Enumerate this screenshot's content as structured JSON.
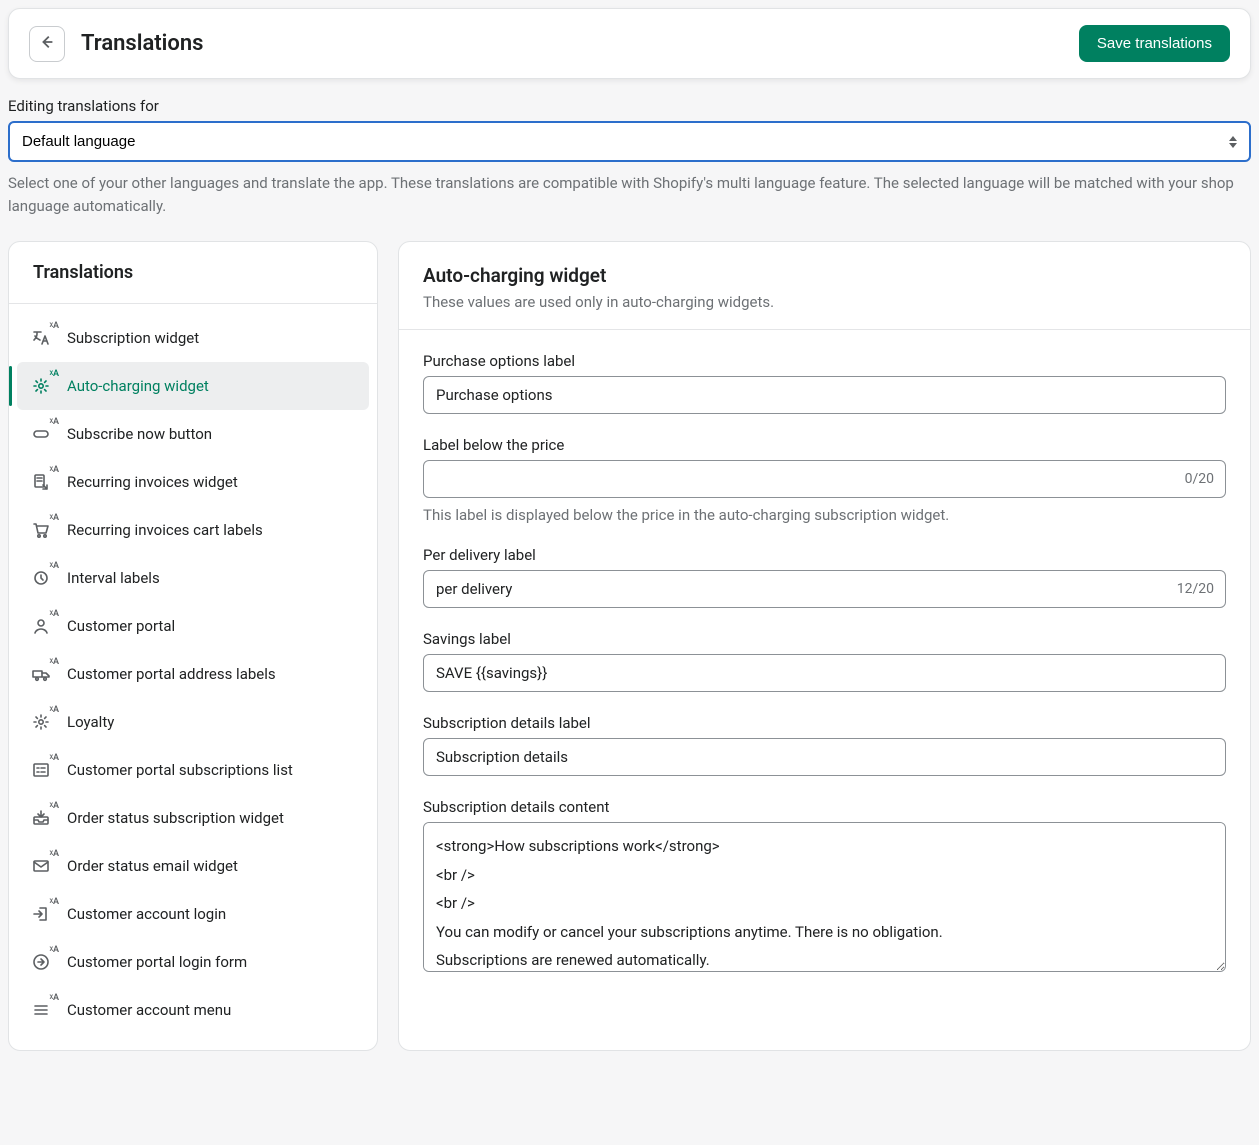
{
  "header": {
    "title": "Translations",
    "save_label": "Save translations"
  },
  "language": {
    "label": "Editing translations for",
    "selected": "Default language",
    "help": "Select one of your other languages and translate the app. These translations are compatible with Shopify's multi language feature. The selected language will be matched with your shop language automatically."
  },
  "sidebar": {
    "title": "Translations",
    "badge": "ᵡA",
    "items": [
      {
        "label": "Subscription widget",
        "icon": "translate"
      },
      {
        "label": "Auto-charging widget",
        "icon": "gear",
        "active": true
      },
      {
        "label": "Subscribe now button",
        "icon": "button"
      },
      {
        "label": "Recurring invoices widget",
        "icon": "invoice-out"
      },
      {
        "label": "Recurring invoices cart labels",
        "icon": "cart"
      },
      {
        "label": "Interval labels",
        "icon": "clock"
      },
      {
        "label": "Customer portal",
        "icon": "person"
      },
      {
        "label": "Customer portal address labels",
        "icon": "truck"
      },
      {
        "label": "Loyalty",
        "icon": "gear"
      },
      {
        "label": "Customer portal subscriptions list",
        "icon": "list-box"
      },
      {
        "label": "Order status subscription widget",
        "icon": "inbox"
      },
      {
        "label": "Order status email widget",
        "icon": "mail"
      },
      {
        "label": "Customer account login",
        "icon": "login"
      },
      {
        "label": "Customer portal login form",
        "icon": "login-circle"
      },
      {
        "label": "Customer account menu",
        "icon": "menu"
      }
    ]
  },
  "section": {
    "title": "Auto-charging widget",
    "subtitle": "These values are used only in auto-charging widgets."
  },
  "fields": {
    "purchase_options": {
      "label": "Purchase options label",
      "value": "Purchase options"
    },
    "label_below_price": {
      "label": "Label below the price",
      "value": "",
      "count": "0/20",
      "help": "This label is displayed below the price in the auto-charging subscription widget."
    },
    "per_delivery": {
      "label": "Per delivery label",
      "value": "per delivery",
      "count": "12/20"
    },
    "savings": {
      "label": "Savings label",
      "value": "SAVE {{savings}}"
    },
    "sub_details_label": {
      "label": "Subscription details label",
      "value": "Subscription details"
    },
    "sub_details_content": {
      "label": "Subscription details content",
      "value": "<strong>How subscriptions work</strong>\n<br />\n<br />\nYou can modify or cancel your subscriptions anytime. There is no obligation.\nSubscriptions are renewed automatically."
    }
  }
}
